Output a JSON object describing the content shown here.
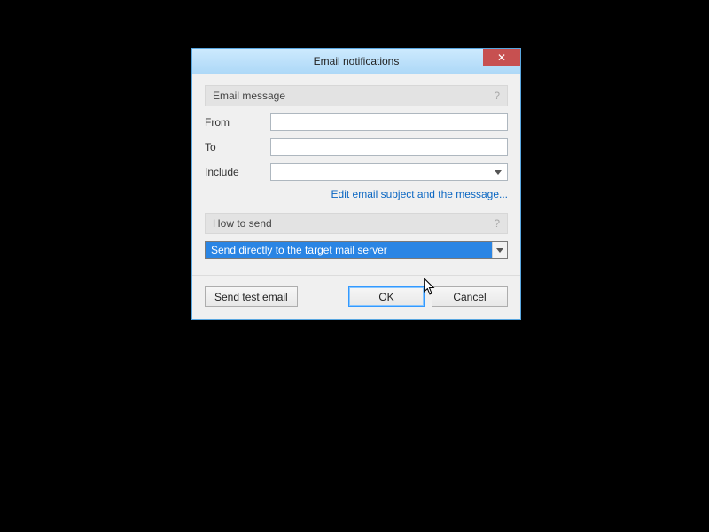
{
  "window": {
    "title": "Email notifications"
  },
  "sections": {
    "message": {
      "header": "Email message",
      "help": "?",
      "from_label": "From",
      "from_value": "",
      "to_label": "To",
      "to_value": "",
      "include_label": "Include",
      "include_value": "",
      "edit_link": "Edit email subject and the message..."
    },
    "send": {
      "header": "How to send",
      "help": "?",
      "method_selected": "Send directly to the target mail server"
    }
  },
  "buttons": {
    "send_test": "Send test email",
    "ok": "OK",
    "cancel": "Cancel"
  }
}
